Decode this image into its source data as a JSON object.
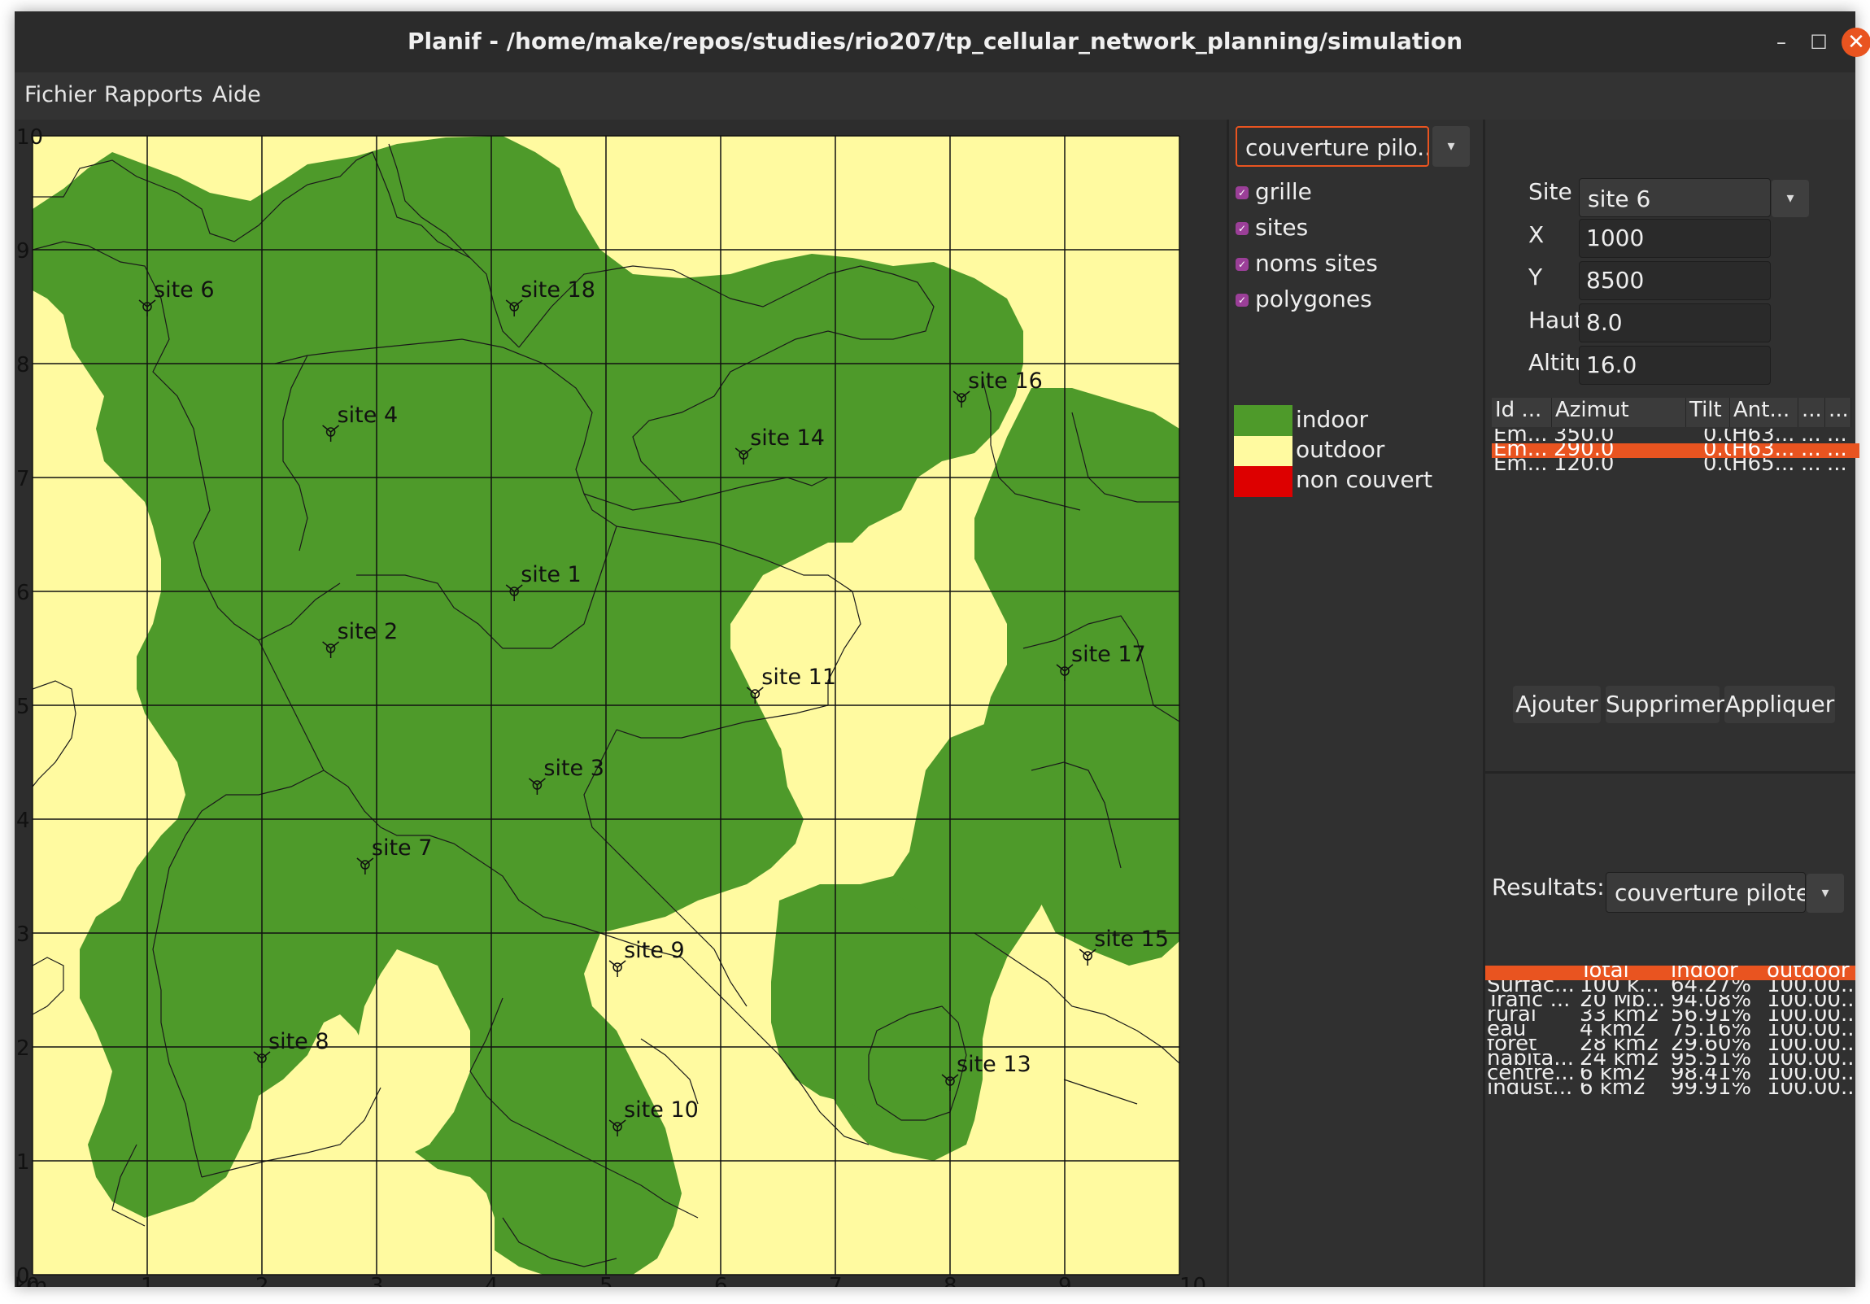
{
  "window": {
    "title": "Planif - /home/make/repos/studies/rio207/tp_cellular_network_planning/simulation",
    "minimize": "–",
    "maximize": "☐",
    "close": "✕"
  },
  "menu": [
    "Fichier",
    "Rapports",
    "Aide"
  ],
  "map": {
    "y_ticks": [
      "10",
      "9",
      "8",
      "7",
      "6",
      "5",
      "4",
      "3",
      "2",
      "1",
      "0"
    ],
    "x_ticks": [
      "0",
      "1",
      "2",
      "3",
      "4",
      "5",
      "6",
      "7",
      "8",
      "9",
      "10"
    ],
    "unit": "km",
    "colors": {
      "indoor": "#4e9a2a",
      "outdoor": "#fffaa0",
      "non_couvert": "#dd0000"
    },
    "sites": [
      {
        "name": "site 6",
        "x": 1.0,
        "y": 8.5
      },
      {
        "name": "site 18",
        "x": 4.2,
        "y": 8.5
      },
      {
        "name": "site 4",
        "x": 2.6,
        "y": 7.4
      },
      {
        "name": "site 16",
        "x": 8.1,
        "y": 7.7
      },
      {
        "name": "site 14",
        "x": 6.2,
        "y": 7.2
      },
      {
        "name": "site 1",
        "x": 4.2,
        "y": 6.0
      },
      {
        "name": "site 2",
        "x": 2.6,
        "y": 5.5
      },
      {
        "name": "site 17",
        "x": 9.0,
        "y": 5.3
      },
      {
        "name": "site 11",
        "x": 6.3,
        "y": 5.1
      },
      {
        "name": "site 3",
        "x": 4.4,
        "y": 4.3
      },
      {
        "name": "site 7",
        "x": 2.9,
        "y": 3.6
      },
      {
        "name": "site 15",
        "x": 9.2,
        "y": 2.8
      },
      {
        "name": "site 9",
        "x": 5.1,
        "y": 2.7
      },
      {
        "name": "site 8",
        "x": 2.0,
        "y": 1.9
      },
      {
        "name": "site 13",
        "x": 8.0,
        "y": 1.7
      },
      {
        "name": "site 10",
        "x": 5.1,
        "y": 1.3
      }
    ]
  },
  "panel": {
    "layer_select": "couverture pilo...",
    "checkboxes": [
      "grille",
      "sites",
      "noms sites",
      "polygones"
    ],
    "legend": [
      "indoor",
      "outdoor",
      "non couvert"
    ]
  },
  "site_form": {
    "labels": {
      "site": "Site",
      "x": "X",
      "y": "Y",
      "hauteur": "Hauteur",
      "altitude": "Altitude"
    },
    "site_value": "site 6",
    "x": "1000",
    "y": "8500",
    "hauteur": "8.0",
    "altitude": "16.0"
  },
  "emitters": {
    "headers": [
      "Id ...",
      "Azimut",
      "Tilt",
      "Ant...",
      "...",
      "..."
    ],
    "rows": [
      [
        "Em...",
        "350.0",
        "0.0",
        "H63...",
        "...",
        "..."
      ],
      [
        "Em...",
        "290.0",
        "0.0",
        "H63...",
        "...",
        "..."
      ],
      [
        "Em...",
        "120.0",
        "0.0",
        "H65...",
        "...",
        "..."
      ]
    ],
    "selected_row": 1
  },
  "buttons": {
    "add": "Ajouter",
    "delete": "Supprimer",
    "apply": "Appliquer"
  },
  "results": {
    "label": "Resultats:",
    "select": "couverture pilote",
    "headers": [
      "",
      "Total",
      "indoor",
      "outdoor"
    ],
    "rows": [
      [
        "Surfac...",
        "100 k...",
        "64.27%",
        "100.00..."
      ],
      [
        "Trafic ...",
        "20 Mb...",
        "94.08%",
        "100.00..."
      ],
      [
        "rural",
        "33 km2",
        "56.91%",
        "100.00..."
      ],
      [
        "eau",
        "4 km2",
        "75.16%",
        "100.00..."
      ],
      [
        "foret",
        "28 km2",
        "29.60%",
        "100.00..."
      ],
      [
        "habita...",
        "24 km2",
        "95.51%",
        "100.00..."
      ],
      [
        "centre...",
        "6 km2",
        "98.41%",
        "100.00..."
      ],
      [
        "indust...",
        "6 km2",
        "99.91%",
        "100.00..."
      ]
    ]
  }
}
